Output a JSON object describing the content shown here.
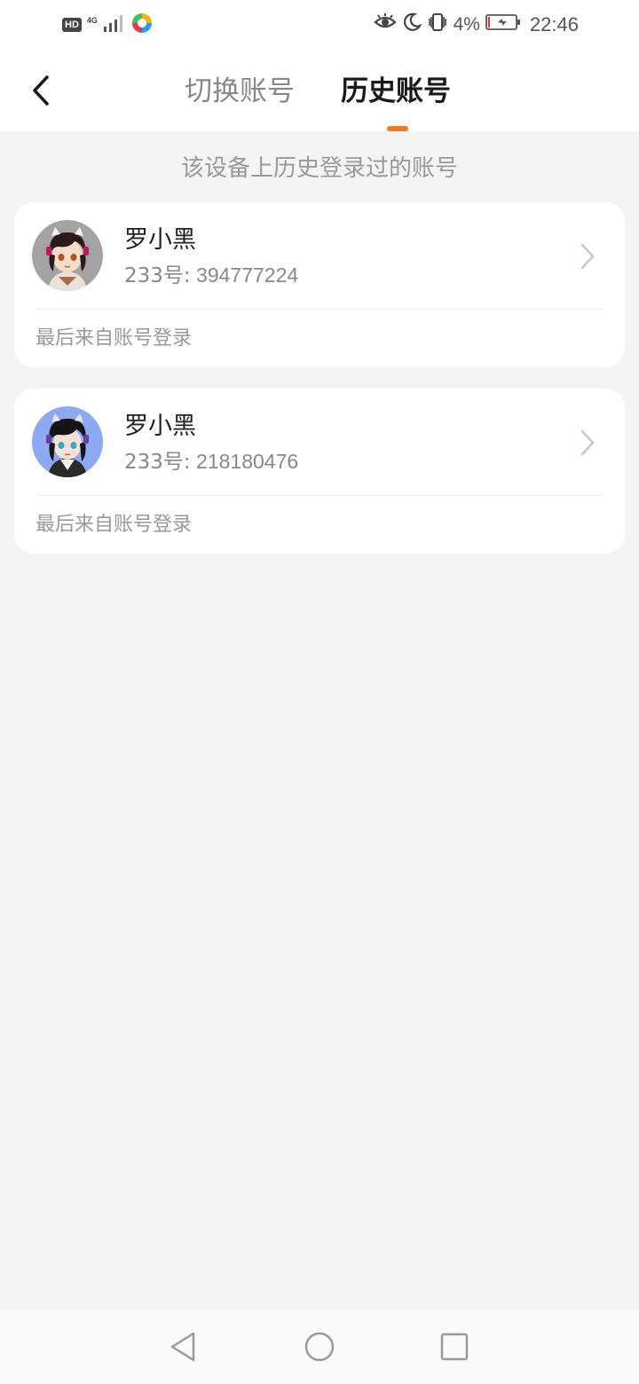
{
  "status_bar": {
    "hd_badge": "HD",
    "network": "4G",
    "battery_percent": "4%",
    "time": "22:46",
    "icons": [
      "signal-icon",
      "app-notification-icon",
      "eye-comfort-icon",
      "do-not-disturb-moon-icon",
      "vibrate-icon",
      "battery-charging-icon"
    ]
  },
  "header": {
    "back_icon": "chevron-left-icon",
    "tabs": [
      {
        "label": "切换账号",
        "active": false
      },
      {
        "label": "历史账号",
        "active": true
      }
    ],
    "accent_color": "#f07a2a"
  },
  "subtitle": "该设备上历史登录过的账号",
  "accounts": [
    {
      "name": "罗小黑",
      "id_label": "233号:",
      "id_value": "394777224",
      "last_login": "最后来自账号登录",
      "avatar_bg": "#9a9a9a"
    },
    {
      "name": "罗小黑",
      "id_label": "233号:",
      "id_value": "218180476",
      "last_login": "最后来自账号登录",
      "avatar_bg": "#8aa8f0"
    }
  ],
  "system_nav": {
    "buttons": [
      "triangle-back-icon",
      "circle-home-icon",
      "square-recents-icon"
    ]
  }
}
